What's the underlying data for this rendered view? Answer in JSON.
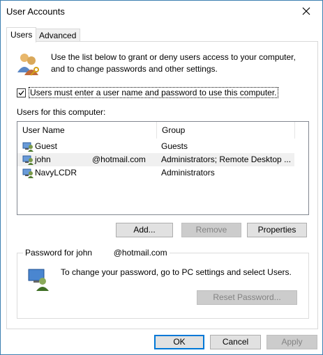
{
  "window": {
    "title": "User Accounts"
  },
  "tabs": [
    {
      "label": "Users"
    },
    {
      "label": "Advanced"
    }
  ],
  "intro": {
    "text": "Use the list below to grant or deny users access to your computer, and to change passwords and other settings."
  },
  "login_checkbox": {
    "label": "Users must enter a user name and password to use this computer.",
    "checked": true
  },
  "users_list": {
    "label": "Users for this computer:",
    "columns": [
      "User Name",
      "Group"
    ],
    "rows": [
      {
        "name": "Guest",
        "email": "",
        "group": "Guests"
      },
      {
        "name": "john",
        "email": "@hotmail.com",
        "group": "Administrators; Remote Desktop ..."
      },
      {
        "name": "NavyLCDR",
        "email": "",
        "group": "Administrators"
      }
    ]
  },
  "list_buttons": {
    "add": "Add...",
    "remove": "Remove",
    "properties": "Properties"
  },
  "password_group": {
    "legend_name": "Password for john",
    "legend_email": "@hotmail.com",
    "text": "To change your password, go to PC settings and select Users.",
    "reset_button": "Reset Password..."
  },
  "footer": {
    "ok": "OK",
    "cancel": "Cancel",
    "apply": "Apply"
  },
  "icons": {
    "close": "close-icon",
    "intro": "users-icon",
    "user": "user-icon",
    "password": "user-key-icon"
  }
}
